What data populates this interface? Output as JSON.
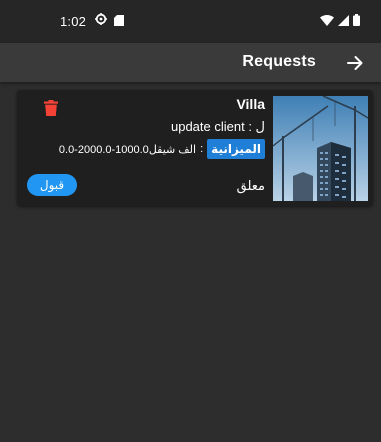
{
  "status_bar": {
    "time": "1:02",
    "icons": [
      "gear-icon",
      "sd-card-icon",
      "wifi-icon",
      "signal-icon",
      "battery-icon"
    ]
  },
  "app_bar": {
    "title": "Requests",
    "nav_icon": "arrow-right-icon"
  },
  "request_card": {
    "title": "Villa",
    "client_line": "ل : update client",
    "budget_label": "الميزانية",
    "budget_separator": ":",
    "budget_value": "0.0-2000.0-1000.0الف شيقل",
    "status": "معلق",
    "accept_label": "قبول",
    "delete_icon": "trash-icon",
    "thumbnail": "construction-crane-building-image"
  },
  "colors": {
    "background": "#2d2d2d",
    "app_bar": "#3a3a3a",
    "card": "#1f1f1f",
    "accent_blue": "#2196f3",
    "chip_blue": "#1f7fd6",
    "delete_red": "#f44336"
  }
}
